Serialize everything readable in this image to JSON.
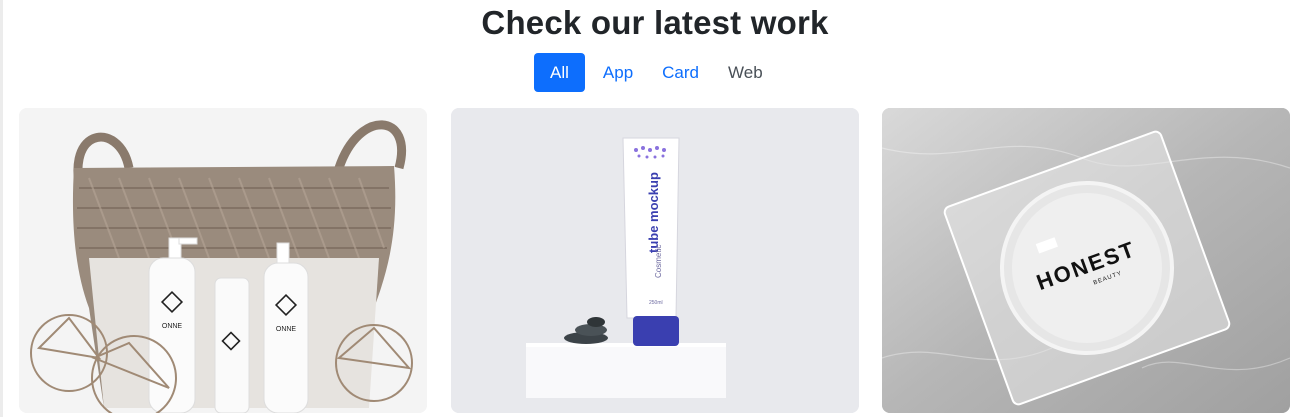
{
  "portfolio": {
    "heading": "Check our latest work",
    "filters": [
      {
        "label": "All",
        "active": true
      },
      {
        "label": "App",
        "active": false
      },
      {
        "label": "Card",
        "active": false
      },
      {
        "label": "Web",
        "active": false
      }
    ]
  },
  "items": [
    {
      "image": "woven-basket-with-onne-skincare-bottles",
      "brand": "ONNE"
    },
    {
      "image": "tube-mockup-on-white-pedestal-with-stones",
      "tube_title": "tube mockup",
      "tube_sub": "Cosmetic",
      "tube_volume": "250ml"
    },
    {
      "image": "honest-beauty-clear-compact-on-marble",
      "brand": "HONEST",
      "brand_sub": "BEAUTY"
    }
  ],
  "colors": {
    "accent": "#0d6efd",
    "heading": "#212529",
    "tube_cap": "#3a3fb0"
  }
}
